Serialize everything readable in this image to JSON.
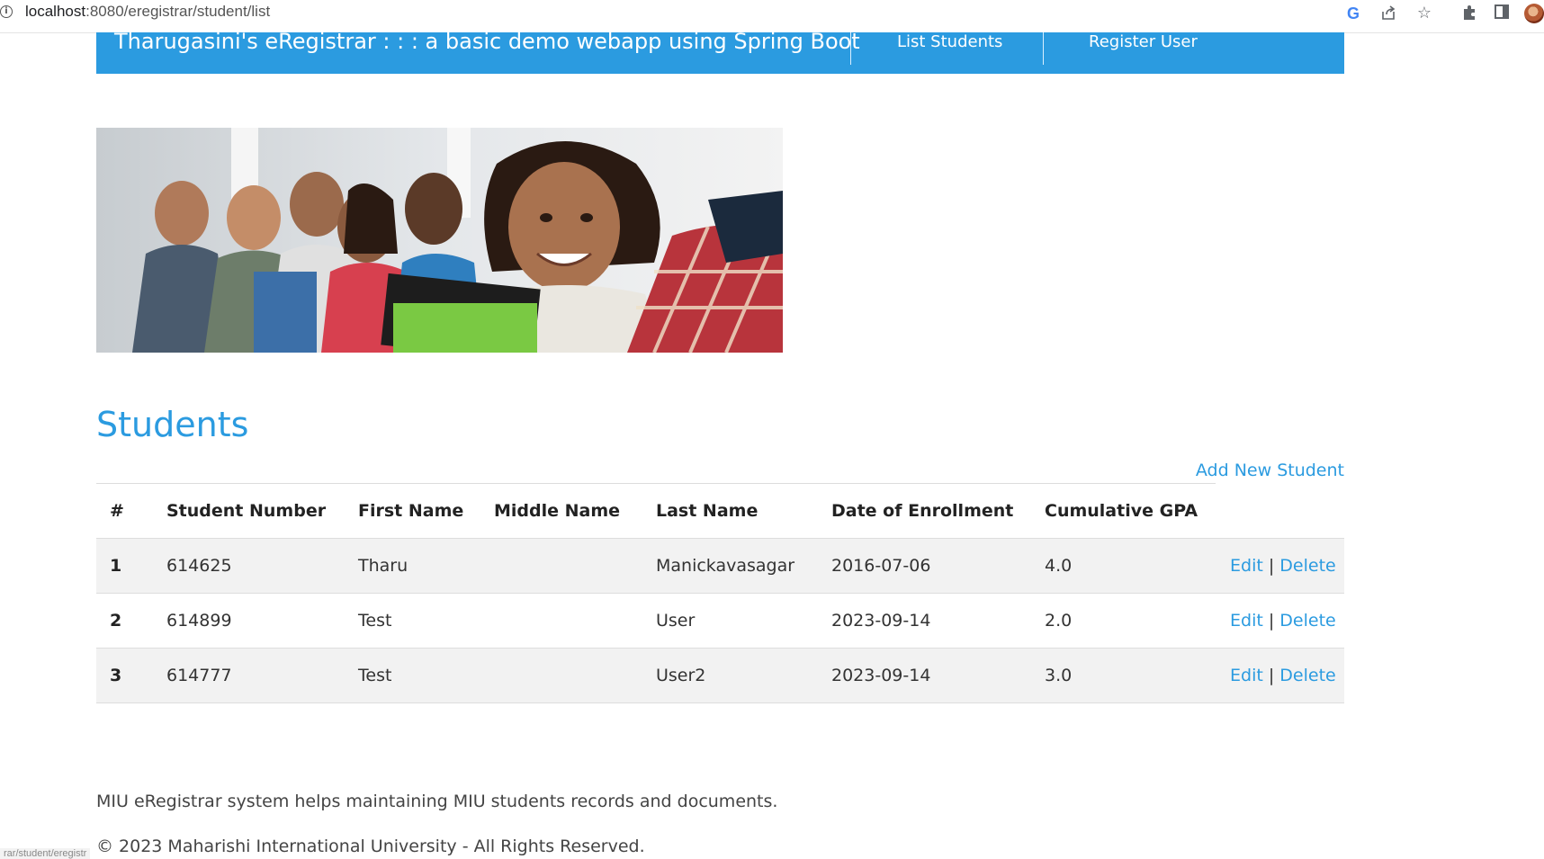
{
  "browser": {
    "url_host": "localhost",
    "url_rest": ":8080/eregistrar/student/list",
    "icons": [
      "info-icon",
      "google-icon",
      "share-icon",
      "star-icon",
      "extensions-icon",
      "sidepanel-icon",
      "avatar-icon"
    ]
  },
  "header": {
    "title": "Tharugasini's eRegistrar : : : a basic demo webapp using Spring Boot",
    "nav": [
      "List Students",
      "Register User"
    ]
  },
  "main": {
    "heading": "Students",
    "add_link": "Add New Student",
    "columns": [
      "#",
      "Student Number",
      "First Name",
      "Middle Name",
      "Last Name",
      "Date of Enrollment",
      "Cumulative GPA"
    ],
    "rows": [
      {
        "num": "1",
        "student_number": "614625",
        "first_name": "Tharu",
        "middle_name": "",
        "last_name": "Manickavasagar",
        "enrollment": "2016-07-06",
        "gpa": "4.0"
      },
      {
        "num": "2",
        "student_number": "614899",
        "first_name": "Test",
        "middle_name": "",
        "last_name": "User",
        "enrollment": "2023-09-14",
        "gpa": "2.0"
      },
      {
        "num": "3",
        "student_number": "614777",
        "first_name": "Test",
        "middle_name": "",
        "last_name": "User2",
        "enrollment": "2023-09-14",
        "gpa": "3.0"
      }
    ],
    "edit_label": "Edit",
    "separator": "|",
    "delete_label": "Delete"
  },
  "footer": {
    "description": "MIU eRegistrar system helps maintaining MIU students records and documents.",
    "copyright": "© 2023 Maharishi International University - All Rights Reserved."
  },
  "status_bar": "rar/student/eregistr",
  "colors": {
    "accent": "#2b9be0",
    "row_stripe": "#f2f2f2"
  }
}
